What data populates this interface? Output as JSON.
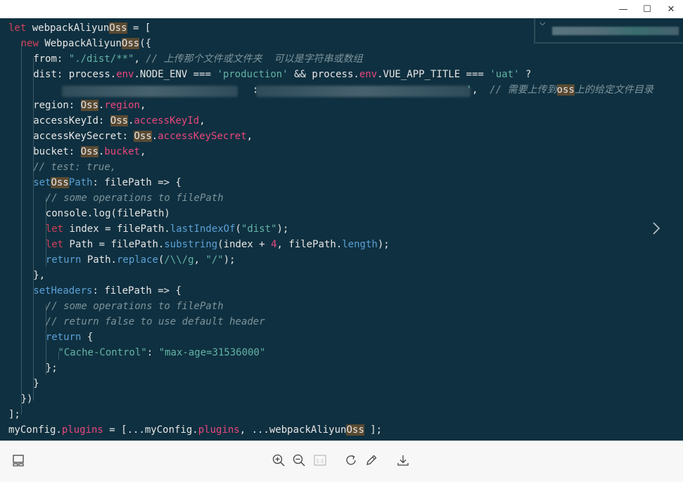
{
  "window": {
    "minimize": "—",
    "maximize": "☐",
    "close": "✕"
  },
  "code": {
    "lines": [
      {
        "indent": 0,
        "tokens": [
          [
            "kw",
            "let "
          ],
          [
            "w",
            "webpackAliyun"
          ],
          [
            "hl",
            "Oss"
          ],
          [
            "w",
            " = ["
          ]
        ]
      },
      {
        "indent": 1,
        "tokens": [
          [
            "kw",
            "new "
          ],
          [
            "w",
            "WebpackAliyun"
          ],
          [
            "hl",
            "Oss"
          ],
          [
            "w",
            "({"
          ]
        ]
      },
      {
        "indent": 2,
        "tokens": [
          [
            "w",
            "from: "
          ],
          [
            "str",
            "\"./dist/**\""
          ],
          [
            "w",
            ", "
          ],
          [
            "cm",
            "// 上传那个文件或文件夹  可以是字符串或数组"
          ]
        ]
      },
      {
        "indent": 2,
        "tokens": [
          [
            "w",
            "dist: process."
          ],
          [
            "mem",
            "env"
          ],
          [
            "w",
            ".NODE_ENV === "
          ],
          [
            "str",
            "'production'"
          ],
          [
            "w",
            " && process."
          ],
          [
            "mem",
            "env"
          ],
          [
            "w",
            ".VUE_APP_TITLE === "
          ],
          [
            "str",
            "'uat'"
          ],
          [
            "w",
            " ?"
          ]
        ]
      },
      {
        "indent": 2,
        "tokens": [
          [
            "w",
            "                                     : "
          ],
          [
            "w",
            "                                  "
          ],
          [
            "str",
            "'"
          ],
          [
            "w",
            ",  "
          ],
          [
            "cm",
            "// 需要上传到"
          ],
          [
            "hl",
            "oss"
          ],
          [
            "cm",
            "上的给定文件目录"
          ]
        ]
      },
      {
        "indent": 2,
        "tokens": [
          [
            "w",
            "region: "
          ],
          [
            "hl",
            "Oss"
          ],
          [
            "w",
            "."
          ],
          [
            "mem",
            "region"
          ],
          [
            "w",
            ","
          ]
        ]
      },
      {
        "indent": 2,
        "tokens": [
          [
            "w",
            "accessKeyId: "
          ],
          [
            "hl",
            "Oss"
          ],
          [
            "w",
            "."
          ],
          [
            "mem",
            "accessKeyId"
          ],
          [
            "w",
            ","
          ]
        ]
      },
      {
        "indent": 2,
        "tokens": [
          [
            "w",
            "accessKeySecret: "
          ],
          [
            "hl",
            "Oss"
          ],
          [
            "w",
            "."
          ],
          [
            "mem",
            "accessKeySecret"
          ],
          [
            "w",
            ","
          ]
        ]
      },
      {
        "indent": 2,
        "tokens": [
          [
            "w",
            "bucket: "
          ],
          [
            "hl",
            "Oss"
          ],
          [
            "w",
            "."
          ],
          [
            "mem",
            "bucket"
          ],
          [
            "w",
            ","
          ]
        ]
      },
      {
        "indent": 2,
        "tokens": [
          [
            "cm",
            "// test: true,"
          ]
        ]
      },
      {
        "indent": 2,
        "tokens": [
          [
            "fn",
            "set"
          ],
          [
            "hl",
            "Oss"
          ],
          [
            "fn",
            "Path"
          ],
          [
            "w",
            ": filePath => {"
          ]
        ]
      },
      {
        "indent": 3,
        "tokens": [
          [
            "cm",
            "// some operations to filePath"
          ]
        ]
      },
      {
        "indent": 3,
        "tokens": [
          [
            "w",
            "console.log(filePath)"
          ]
        ]
      },
      {
        "indent": 3,
        "tokens": [
          [
            "kw",
            "let "
          ],
          [
            "w",
            "index = filePath."
          ],
          [
            "fn",
            "lastIndexOf"
          ],
          [
            "w",
            "("
          ],
          [
            "str",
            "\"dist\""
          ],
          [
            "w",
            ");"
          ]
        ]
      },
      {
        "indent": 3,
        "tokens": [
          [
            "kw",
            "let "
          ],
          [
            "w",
            "Path = filePath."
          ],
          [
            "fn",
            "substring"
          ],
          [
            "w",
            "(index + "
          ],
          [
            "num",
            "4"
          ],
          [
            "w",
            ", filePath."
          ],
          [
            "fn",
            "length"
          ],
          [
            "w",
            ");"
          ]
        ]
      },
      {
        "indent": 3,
        "tokens": [
          [
            "lit",
            "return "
          ],
          [
            "w",
            "Path."
          ],
          [
            "fn",
            "replace"
          ],
          [
            "w",
            "("
          ],
          [
            "str",
            "/\\\\/g"
          ],
          [
            "w",
            ", "
          ],
          [
            "str",
            "\"/\""
          ],
          [
            "w",
            ");"
          ]
        ]
      },
      {
        "indent": 2,
        "tokens": [
          [
            "w",
            "},"
          ]
        ]
      },
      {
        "indent": 2,
        "tokens": [
          [
            "fn",
            "setHeaders"
          ],
          [
            "w",
            ": filePath => {"
          ]
        ]
      },
      {
        "indent": 3,
        "tokens": [
          [
            "cm",
            "// some operations to filePath"
          ]
        ]
      },
      {
        "indent": 3,
        "tokens": [
          [
            "cm",
            "// return false to use default header"
          ]
        ]
      },
      {
        "indent": 3,
        "tokens": [
          [
            "lit",
            "return "
          ],
          [
            "w",
            "{"
          ]
        ]
      },
      {
        "indent": 4,
        "tokens": [
          [
            "str",
            "\"Cache-Control\""
          ],
          [
            "w",
            ": "
          ],
          [
            "str",
            "\"max-age=31536000\""
          ]
        ]
      },
      {
        "indent": 3,
        "tokens": [
          [
            "w",
            "};"
          ]
        ]
      },
      {
        "indent": 2,
        "tokens": [
          [
            "w",
            "}"
          ]
        ]
      },
      {
        "indent": 1,
        "tokens": [
          [
            "w",
            "})"
          ]
        ]
      },
      {
        "indent": 0,
        "tokens": [
          [
            "w",
            "];"
          ]
        ]
      },
      {
        "indent": 0,
        "tokens": [
          [
            "w",
            "myConfig."
          ],
          [
            "mem",
            "plugins"
          ],
          [
            "w",
            " = [...myConfig."
          ],
          [
            "mem",
            "plugins"
          ],
          [
            "w",
            ", ...webpackAliyun"
          ],
          [
            "hl",
            "Oss"
          ],
          [
            "w",
            " ];"
          ]
        ]
      }
    ]
  },
  "toolbar": {
    "items": [
      {
        "name": "toggle-panel-button",
        "icon": "panel-icon"
      },
      {
        "name": "zoom-in-button",
        "icon": "zoom-in-icon"
      },
      {
        "name": "zoom-out-button",
        "icon": "zoom-out-icon"
      },
      {
        "name": "actual-size-button",
        "icon": "one-to-one-icon",
        "label": "1:1"
      },
      {
        "name": "rotate-button",
        "icon": "rotate-icon"
      },
      {
        "name": "edit-button",
        "icon": "pencil-icon"
      },
      {
        "name": "download-button",
        "icon": "download-icon"
      }
    ]
  },
  "colors": {
    "background": "#0f3040",
    "keyword": "#d0405a",
    "string": "#63b3a6",
    "comment": "#7d949c",
    "highlight": "#5a4a32"
  }
}
